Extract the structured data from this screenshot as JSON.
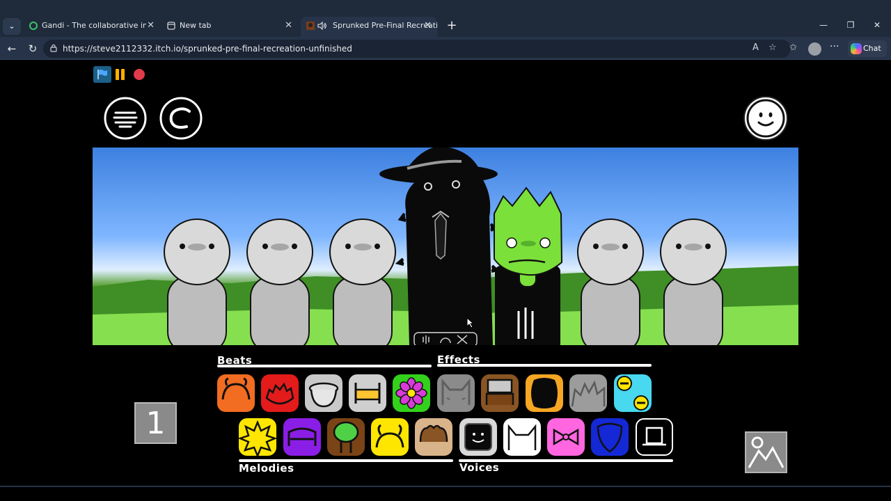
{
  "browser": {
    "tabs": [
      {
        "title": "Gandi - The collaborative in-brow",
        "active": false
      },
      {
        "title": "New tab",
        "active": false
      },
      {
        "title": "Sprunked Pre-Final Recreation",
        "active": true
      }
    ],
    "new_tab": "+",
    "window": {
      "minimize": "—",
      "restore": "❐",
      "close": "✕"
    },
    "url": "https://steve2112332.itch.io/sprunked-pre-final-recreation-unfinished",
    "chat_label": "Chat"
  },
  "game": {
    "page_counter": "1",
    "sections": {
      "beats": "Beats",
      "effects": "Effects",
      "melodies": "Melodies",
      "voices": "Voices"
    },
    "colors": {
      "sky_top": "#3d80e0",
      "grass": "#4b9a2a",
      "character_grey": "#c8c8c8",
      "green_character": "#7be03a"
    },
    "top_row_icons": [
      {
        "name": "orange-beat",
        "color": "#f26c21"
      },
      {
        "name": "red-beat",
        "color": "#e31b1b"
      },
      {
        "name": "grey-pot-beat",
        "color": "#c9c9c9"
      },
      {
        "name": "gold-bed-beat",
        "color": "#cfcfcf"
      },
      {
        "name": "flower-beat",
        "color": "#33d11c"
      },
      {
        "name": "cat-effect",
        "color": "#8b8b8b"
      },
      {
        "name": "brown-box-effect",
        "color": "#8a5524"
      },
      {
        "name": "black-blob-effect",
        "color": "#f5a623"
      },
      {
        "name": "spiky-effect",
        "color": "#9c9c9c"
      },
      {
        "name": "minus-effect",
        "color": "#48d8f0"
      }
    ],
    "bottom_row_icons": [
      {
        "name": "star-melody",
        "color": "#ffe600"
      },
      {
        "name": "purple-melody",
        "color": "#8a1ee6"
      },
      {
        "name": "tree-melody",
        "color": "#7a4416"
      },
      {
        "name": "antenna-melody",
        "color": "#ffe600"
      },
      {
        "name": "hair-melody",
        "color": "#d9b38a"
      },
      {
        "name": "tv-voice",
        "color": "#d9d9d9"
      },
      {
        "name": "white-cat-voice",
        "color": "#ffffff"
      },
      {
        "name": "bow-voice",
        "color": "#ff66e0"
      },
      {
        "name": "blue-drop-voice",
        "color": "#1428d6"
      },
      {
        "name": "hat-voice",
        "color": "#000000"
      }
    ]
  }
}
